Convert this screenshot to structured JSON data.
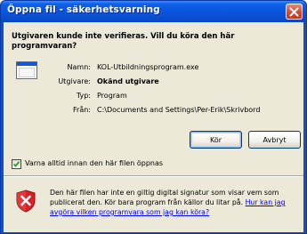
{
  "window": {
    "title": "Öppna fil - säkerhetsvarning"
  },
  "question": "Utgivaren kunde inte verifieras. Vill du köra den här programvaran?",
  "details": [
    {
      "label": "Namn:",
      "value": "KOL-Utbildningsprogram.exe"
    },
    {
      "label": "Utgivare:",
      "value": "Okänd utgivare"
    },
    {
      "label": "Typ:",
      "value": "Program"
    },
    {
      "label": "Från:",
      "value": "C:\\Documents and Settings\\Per-Erik\\Skrivbord"
    }
  ],
  "buttons": {
    "run": "Kör",
    "cancel": "Avbryt"
  },
  "checkbox": {
    "label": "Varna alltid innan den här filen öppnas",
    "checked": true
  },
  "warning": {
    "text": "Den här filen har inte en giltig digital signatur som visar vem som publicerat den. Kör bara program från källor du litar på.",
    "link": "Hur kan jag avgöra vilken programvara som jag kan köra?"
  },
  "icons": {
    "close": "close-icon",
    "application": "application-icon",
    "shield": "security-shield-icon"
  },
  "colors": {
    "titlebar": "#0a54dc",
    "client": "#ece9d8",
    "link": "#0000ff",
    "shield": "#d8202a"
  }
}
